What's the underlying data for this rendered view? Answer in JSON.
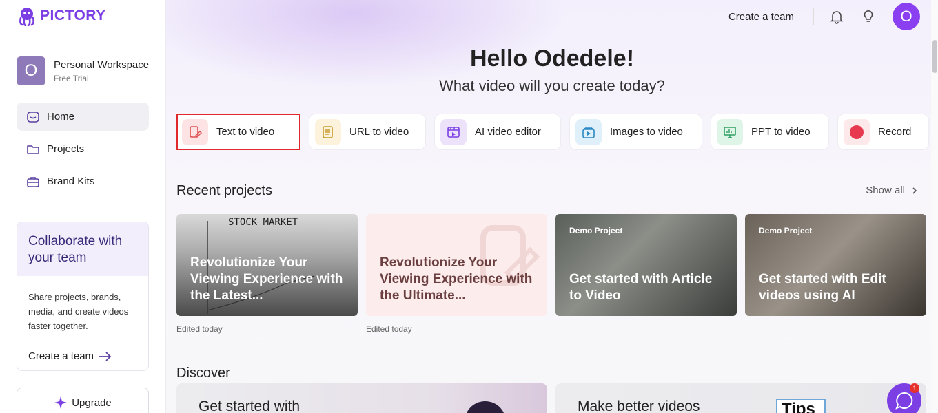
{
  "brand": {
    "name": "PICTORY",
    "accent": "#7b3fe4"
  },
  "workspace": {
    "avatar_letter": "O",
    "name": "Personal Workspace",
    "plan": "Free Trial"
  },
  "sidebar": {
    "items": [
      {
        "label": "Home",
        "icon": "home-icon",
        "active": true
      },
      {
        "label": "Projects",
        "icon": "folder-icon",
        "active": false
      },
      {
        "label": "Brand Kits",
        "icon": "briefcase-icon",
        "active": false
      }
    ],
    "collab": {
      "title": "Collaborate with your team",
      "body": "Share projects, brands, media, and create videos faster together.",
      "link": "Create a team"
    },
    "upgrade_label": "Upgrade"
  },
  "topbar": {
    "create_team": "Create a team",
    "user_initial": "O"
  },
  "hero": {
    "greeting": "Hello Odedele!",
    "question": "What video will you create today?"
  },
  "actions": [
    {
      "label": "Text to video",
      "icon": "text-to-video-icon",
      "color": "#fde3e3",
      "selected": true
    },
    {
      "label": "URL to video",
      "icon": "url-doc-icon",
      "color": "#fdf3dc",
      "selected": false
    },
    {
      "label": "AI video editor",
      "icon": "ai-editor-icon",
      "color": "#ece3fb",
      "selected": false
    },
    {
      "label": "Images to video",
      "icon": "images-video-icon",
      "color": "#dff0fb",
      "selected": false
    },
    {
      "label": "PPT to video",
      "icon": "ppt-icon",
      "color": "#dff5e8",
      "selected": false
    },
    {
      "label": "Record",
      "icon": "record-icon",
      "color": "#fde8ea",
      "selected": false
    }
  ],
  "recent": {
    "title": "Recent projects",
    "show_all": "Show all",
    "cards": [
      {
        "title": "Revolutionize Your Viewing Experience with the Latest...",
        "tag": "",
        "meta": "Edited today",
        "overlay_text": "STOCK MARKET"
      },
      {
        "title": "Revolutionize Your Viewing Experience with the Ultimate...",
        "tag": "",
        "meta": "Edited today"
      },
      {
        "title": "Get started with Article to Video",
        "tag": "Demo Project",
        "meta": ""
      },
      {
        "title": "Get started with Edit videos using AI",
        "tag": "Demo Project",
        "meta": ""
      }
    ]
  },
  "discover": {
    "title": "Discover",
    "cards": [
      {
        "title": "Get started with"
      },
      {
        "title": "Make better videos",
        "badge": "Tips"
      }
    ]
  },
  "chat": {
    "badge_count": "1"
  }
}
